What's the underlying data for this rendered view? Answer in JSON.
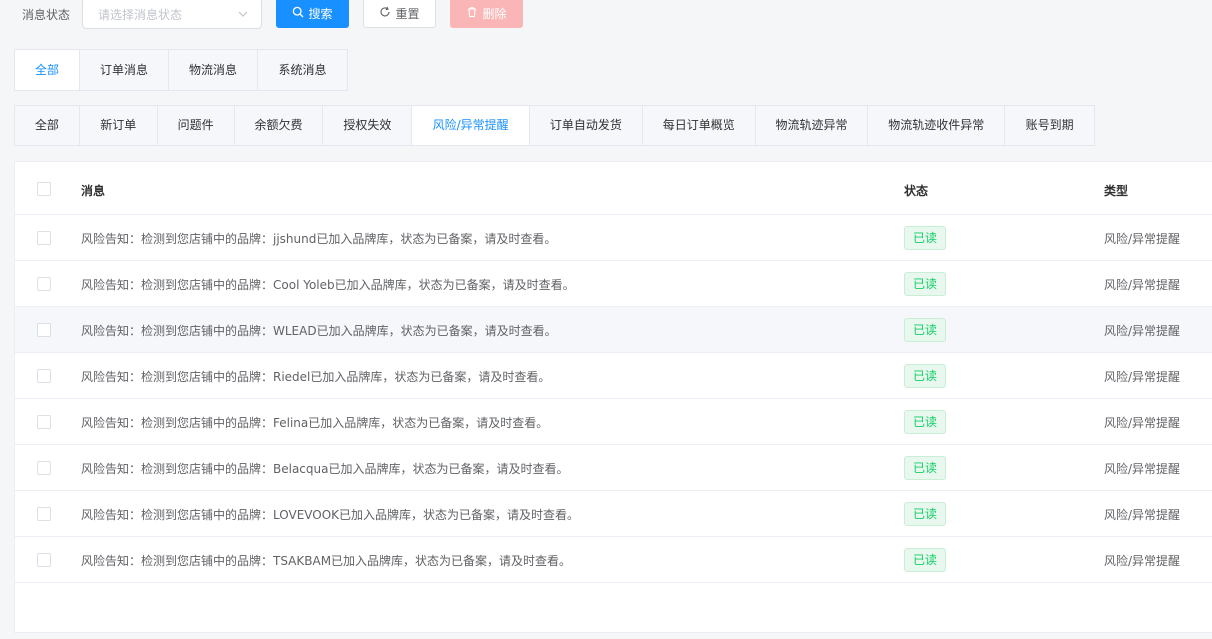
{
  "filter": {
    "label": "消息状态",
    "select_placeholder": "请选择消息状态",
    "search_label": "搜索",
    "reset_label": "重置",
    "delete_label": "删除"
  },
  "primary_tabs": [
    "全部",
    "订单消息",
    "物流消息",
    "系统消息"
  ],
  "primary_active": 0,
  "secondary_tabs": [
    "全部",
    "新订单",
    "问题件",
    "余额欠费",
    "授权失效",
    "风险/异常提醒",
    "订单自动发货",
    "每日订单概览",
    "物流轨迹异常",
    "物流轨迹收件异常",
    "账号到期"
  ],
  "secondary_active": 5,
  "table": {
    "columns": {
      "message": "消息",
      "status": "状态",
      "type": "类型"
    },
    "rows": [
      {
        "message": "风险告知：检测到您店铺中的品牌：jjshund已加入品牌库，状态为已备案，请及时查看。",
        "status": "已读",
        "type": "风险/异常提醒"
      },
      {
        "message": "风险告知：检测到您店铺中的品牌：Cool Yoleb已加入品牌库，状态为已备案，请及时查看。",
        "status": "已读",
        "type": "风险/异常提醒"
      },
      {
        "message": "风险告知：检测到您店铺中的品牌：WLEAD已加入品牌库，状态为已备案，请及时查看。",
        "status": "已读",
        "type": "风险/异常提醒"
      },
      {
        "message": "风险告知：检测到您店铺中的品牌：Riedel已加入品牌库，状态为已备案，请及时查看。",
        "status": "已读",
        "type": "风险/异常提醒"
      },
      {
        "message": "风险告知：检测到您店铺中的品牌：Felina已加入品牌库，状态为已备案，请及时查看。",
        "status": "已读",
        "type": "风险/异常提醒"
      },
      {
        "message": "风险告知：检测到您店铺中的品牌：Belacqua已加入品牌库，状态为已备案，请及时查看。",
        "status": "已读",
        "type": "风险/异常提醒"
      },
      {
        "message": "风险告知：检测到您店铺中的品牌：LOVEVOOK已加入品牌库，状态为已备案，请及时查看。",
        "status": "已读",
        "type": "风险/异常提醒"
      },
      {
        "message": "风险告知：检测到您店铺中的品牌：TSAKBAM已加入品牌库，状态为已备案，请及时查看。",
        "status": "已读",
        "type": "风险/异常提醒"
      }
    ]
  },
  "colors": {
    "primary": "#1890ff",
    "danger_disabled": "#fab6b6",
    "success": "#13ce66"
  }
}
